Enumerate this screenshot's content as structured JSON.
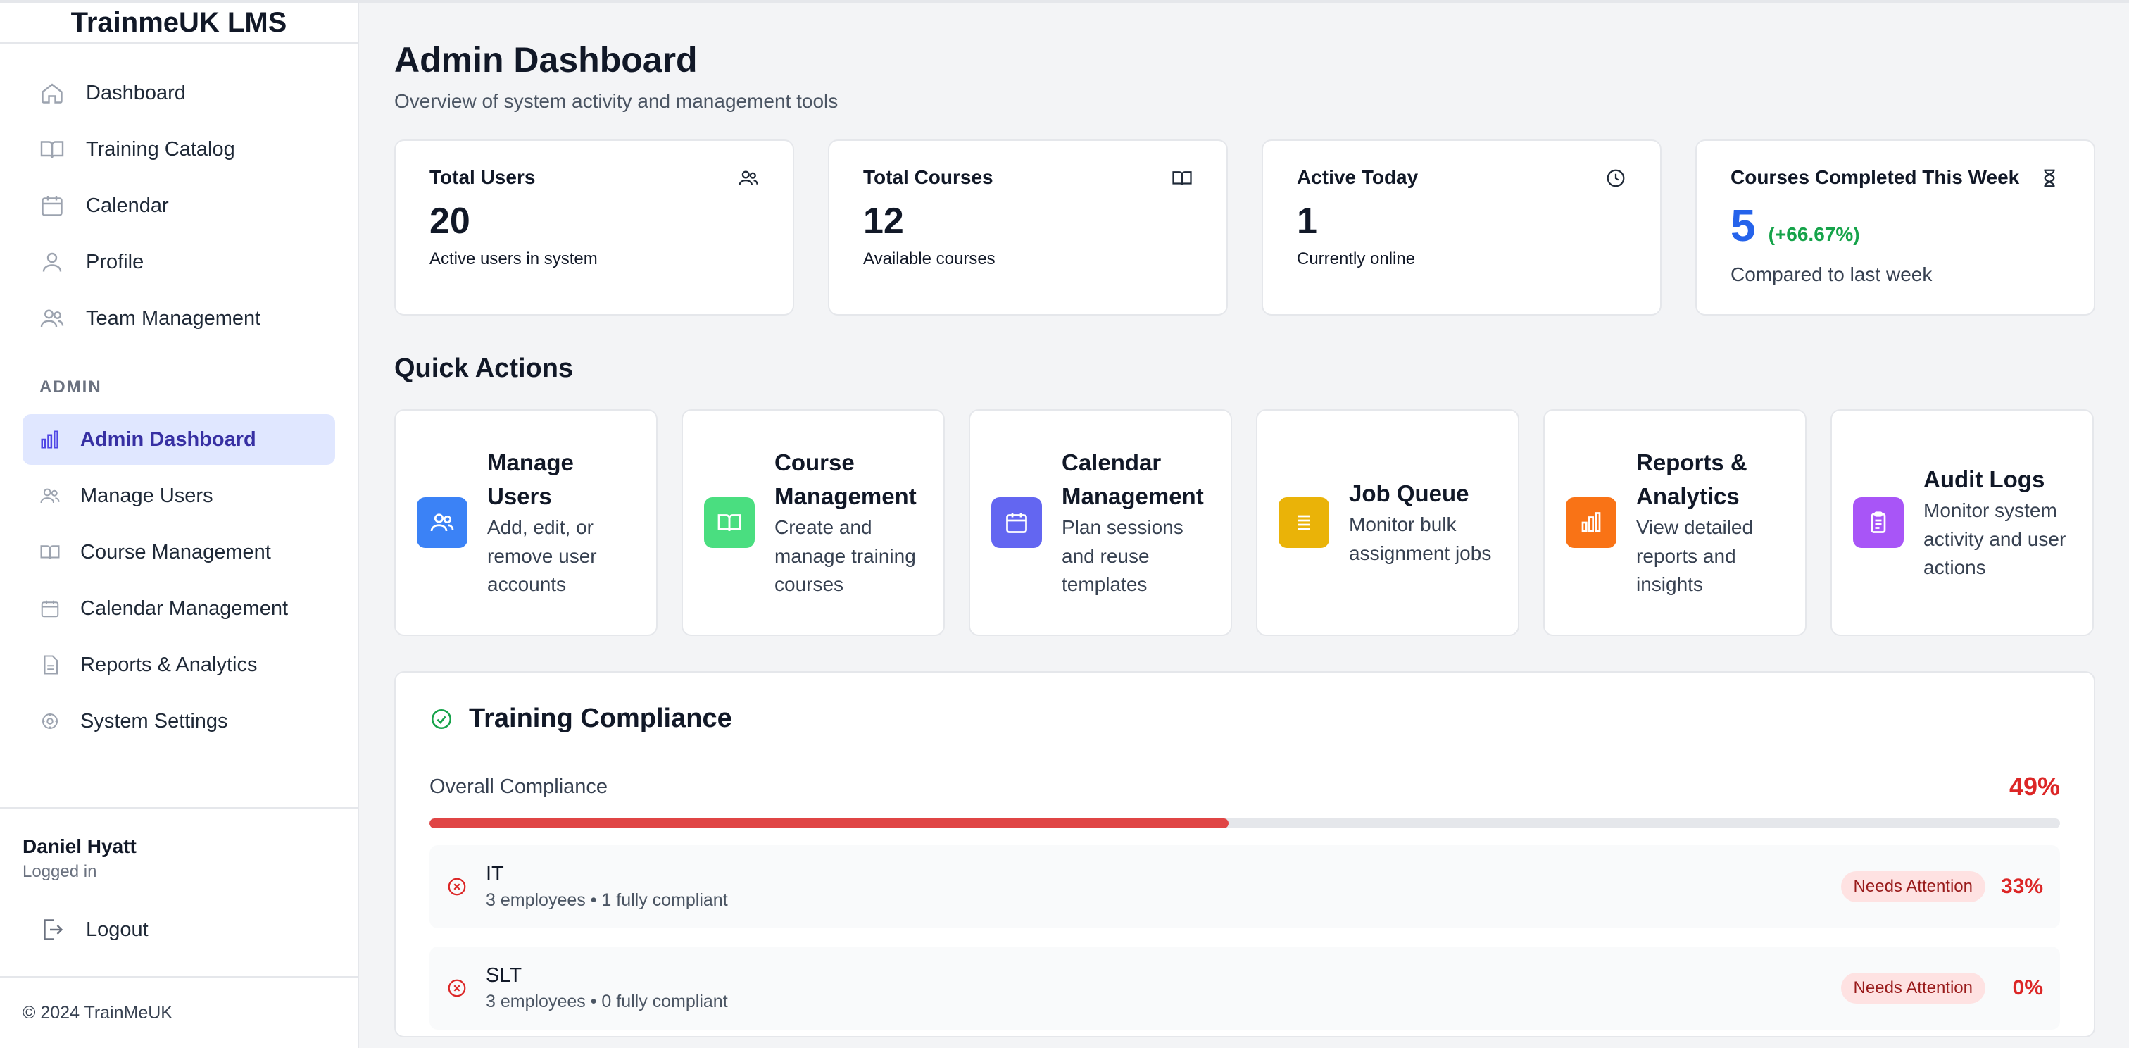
{
  "app": {
    "title": "TrainmeUK LMS"
  },
  "sidebar": {
    "items": [
      {
        "label": "Dashboard",
        "icon": "home-icon"
      },
      {
        "label": "Training Catalog",
        "icon": "book-icon"
      },
      {
        "label": "Calendar",
        "icon": "calendar-icon"
      },
      {
        "label": "Profile",
        "icon": "user-icon"
      },
      {
        "label": "Team Management",
        "icon": "users-icon"
      }
    ],
    "admin_label": "ADMIN",
    "admin_items": [
      {
        "label": "Admin Dashboard",
        "icon": "bar-chart-icon",
        "active": true
      },
      {
        "label": "Manage Users",
        "icon": "users-icon"
      },
      {
        "label": "Course Management",
        "icon": "book-icon"
      },
      {
        "label": "Calendar Management",
        "icon": "calendar-icon"
      },
      {
        "label": "Reports & Analytics",
        "icon": "file-icon"
      },
      {
        "label": "System Settings",
        "icon": "settings-icon"
      }
    ],
    "user": {
      "name": "Daniel Hyatt",
      "status": "Logged in"
    },
    "logout_label": "Logout",
    "footer": "© 2024 TrainMeUK"
  },
  "header": {
    "title": "Admin Dashboard",
    "subtitle": "Overview of system activity and management tools"
  },
  "stats": [
    {
      "title": "Total Users",
      "value": "20",
      "desc": "Active users in system",
      "icon": "users-icon"
    },
    {
      "title": "Total Courses",
      "value": "12",
      "desc": "Available courses",
      "icon": "book-icon"
    },
    {
      "title": "Active Today",
      "value": "1",
      "desc": "Currently online",
      "icon": "clock-icon"
    },
    {
      "title": "Courses Completed This Week",
      "value": "5",
      "change": "(+66.67%)",
      "desc": "Compared to last week",
      "icon": "hourglass-icon"
    }
  ],
  "quick_actions": {
    "title": "Quick Actions",
    "items": [
      {
        "title": "Manage Users",
        "desc": "Add, edit, or remove user accounts",
        "icon": "users-icon",
        "color": "#3b82f6"
      },
      {
        "title": "Course Management",
        "desc": "Create and manage training courses",
        "icon": "book-icon",
        "color": "#4ade80"
      },
      {
        "title": "Calendar Management",
        "desc": "Plan sessions and reuse templates",
        "icon": "calendar-icon",
        "color": "#6366f1"
      },
      {
        "title": "Job Queue",
        "desc": "Monitor bulk assignment jobs",
        "icon": "list-icon",
        "color": "#eab308"
      },
      {
        "title": "Reports & Analytics",
        "desc": "View detailed reports and insights",
        "icon": "bar-chart-icon",
        "color": "#f97316"
      },
      {
        "title": "Audit Logs",
        "desc": "Monitor system activity and user actions",
        "icon": "clipboard-icon",
        "color": "#a855f7"
      }
    ]
  },
  "compliance": {
    "title": "Training Compliance",
    "overall_label": "Overall Compliance",
    "overall_pct": "49%",
    "overall_value": 0.49,
    "departments": [
      {
        "name": "IT",
        "meta": "3 employees • 1 fully compliant",
        "badge": "Needs Attention",
        "pct": "33%"
      },
      {
        "name": "SLT",
        "meta": "3 employees • 0 fully compliant",
        "badge": "Needs Attention",
        "pct": "0%"
      }
    ]
  }
}
